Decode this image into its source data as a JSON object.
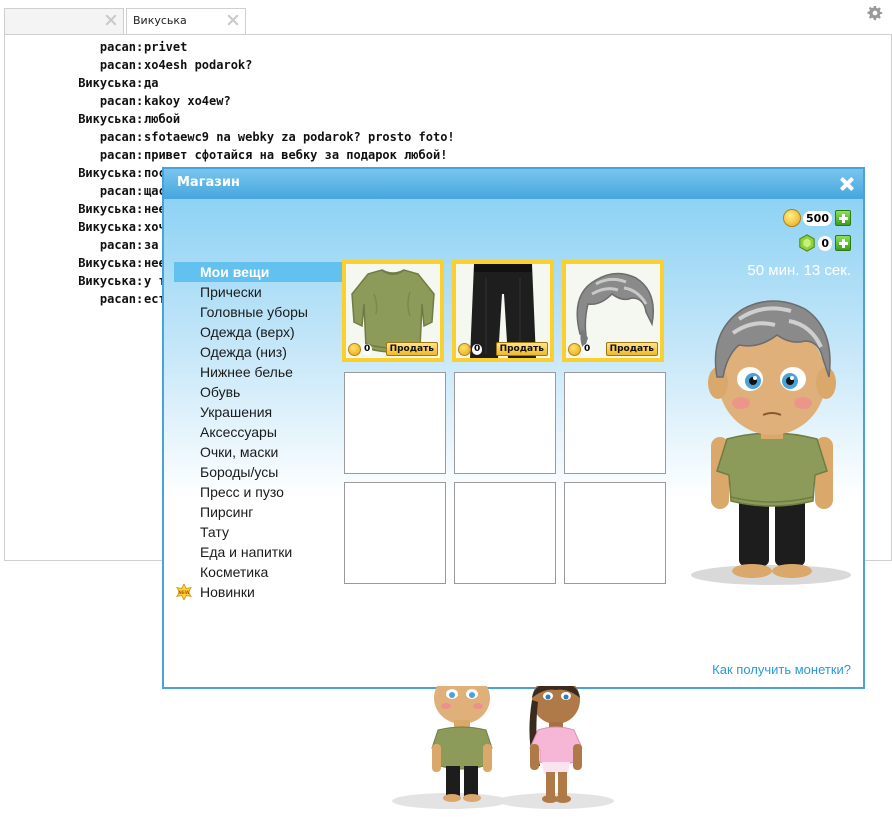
{
  "tabs": [
    {
      "label": ""
    },
    {
      "label": "Викуська"
    }
  ],
  "chat": {
    "messages": [
      {
        "nick": "pacan",
        "text": "privet"
      },
      {
        "nick": "pacan",
        "text": "xo4esh podarok?"
      },
      {
        "nick": "Викуська",
        "text": "да"
      },
      {
        "nick": "pacan",
        "text": "kakoy xo4ew?"
      },
      {
        "nick": "Викуська",
        "text": "любой"
      },
      {
        "nick": "pacan",
        "text": "sfotaewc9 na webky za podarok? prosto foto!"
      },
      {
        "nick": "pacan",
        "text": "привет сфотайся на вебку за подарок любой!"
      },
      {
        "nick": "Викуська",
        "text": "пос"
      },
      {
        "nick": "pacan",
        "text": "щас"
      },
      {
        "nick": "Викуська",
        "text": "нее"
      },
      {
        "nick": "Викуська",
        "text": "хоч"
      },
      {
        "nick": "pacan",
        "text": "за"
      },
      {
        "nick": "Викуська",
        "text": "нее"
      },
      {
        "nick": "Викуська",
        "text": "у т"
      },
      {
        "nick": "pacan",
        "text": "ест"
      }
    ]
  },
  "shop": {
    "title": "Магазин",
    "categories": [
      "Мои вещи",
      "Прически",
      "Головные уборы",
      "Одежда (верх)",
      "Одежда (низ)",
      "Нижнее белье",
      "Обувь",
      "Украшения",
      "Аксессуары",
      "Очки, маски",
      "Бороды/усы",
      "Пресс и пузо",
      "Пирсинг",
      "Тату",
      "Еда и напитки",
      "Косметика",
      "Новинки"
    ],
    "active_category": "Мои вещи",
    "new_badge": "NEW",
    "items": [
      {
        "icon": "olive-shirt-icon",
        "price": "0",
        "sell_label": "Продать"
      },
      {
        "icon": "black-pants-icon",
        "price": "0",
        "sell_label": "Продать"
      },
      {
        "icon": "gray-hair-icon",
        "price": "0",
        "sell_label": "Продать"
      }
    ],
    "coins": "500",
    "gems": "0",
    "timer": "50 мин. 13 сек.",
    "help_link": "Как получить монетки?"
  },
  "colors": {
    "accent": "#4aa3d8",
    "item_frame": "#fbcf2e",
    "active_category": "#62c1ee",
    "link": "#2a9ad6"
  }
}
